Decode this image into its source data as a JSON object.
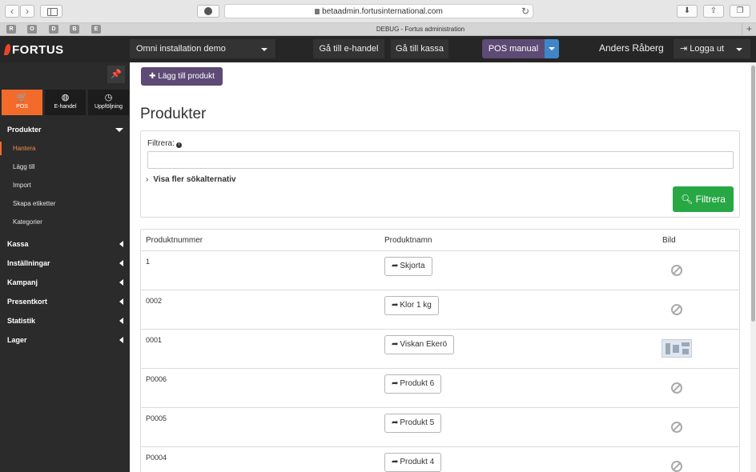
{
  "browser": {
    "url": "betaadmin.fortusinternational.com",
    "tab_title": "DEBUG - Fortus administration",
    "favicons": [
      "R",
      "O",
      "D",
      "B",
      "E"
    ]
  },
  "topbar": {
    "logo": "FORTUS",
    "store": "Omni installation demo",
    "link_ehandel": "Gå till e-handel",
    "link_kassa": "Gå till kassa",
    "pos_manual": "POS manual",
    "user": "Anders Råberg",
    "logout": "Logga ut"
  },
  "sidebar": {
    "modules": [
      {
        "label": "POS",
        "icon": "cart-icon",
        "glyph": "🛒"
      },
      {
        "label": "E-handel",
        "icon": "globe-icon",
        "glyph": "◍"
      },
      {
        "label": "Uppföljning",
        "icon": "clock-icon",
        "glyph": "◷"
      }
    ],
    "sections": {
      "produkter": "Produkter",
      "kassa": "Kassa",
      "installningar": "Inställningar",
      "kampanj": "Kampanj",
      "presentkort": "Presentkort",
      "statistik": "Statistik",
      "lager": "Lager"
    },
    "produkter_items": [
      "Hantera",
      "Lägg till",
      "Import",
      "Skapa etiketter",
      "Kategorier"
    ]
  },
  "content": {
    "add_button": "Lägg till produkt",
    "title": "Produkter",
    "filter_label": "Filtrera:",
    "filter_value": "",
    "more_options": "Visa fler sökalternativ",
    "filter_button": "Filtrera",
    "columns": [
      "Produktnummer",
      "Produktnamn",
      "Bild"
    ],
    "rows": [
      {
        "number": "1",
        "name": "Skjorta",
        "image": "none"
      },
      {
        "number": "0002",
        "name": "Klor 1 kg",
        "image": "none"
      },
      {
        "number": "0001",
        "name": "Viskan Ekerö",
        "image": "thumbnail"
      },
      {
        "number": "P0006",
        "name": "Produkt 6",
        "image": "none"
      },
      {
        "number": "P0005",
        "name": "Produkt 5",
        "image": "none"
      },
      {
        "number": "P0004",
        "name": "Produkt 4",
        "image": "none"
      }
    ]
  },
  "colors": {
    "accent_orange": "#f26b2b",
    "purple": "#5d4a75",
    "green": "#27a844",
    "blue": "#3f86c8"
  }
}
